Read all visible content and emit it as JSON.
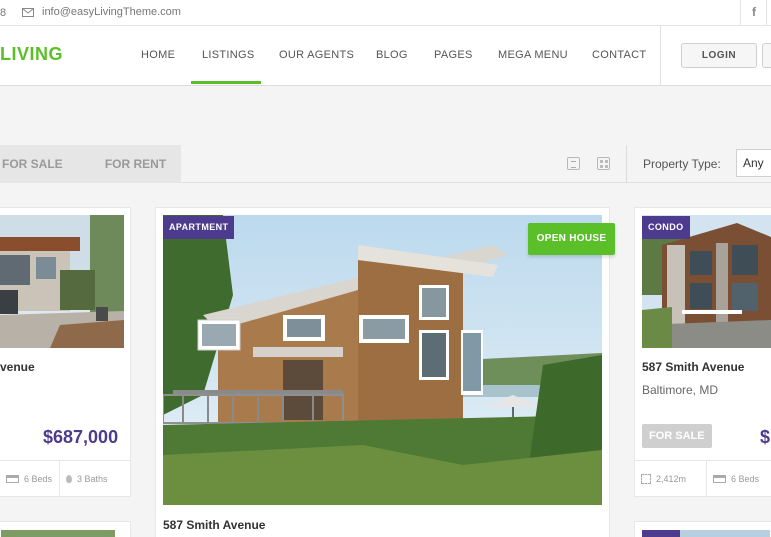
{
  "topbar": {
    "phone_tail": "8",
    "email": "info@easyLivingTheme.com",
    "social": "f"
  },
  "header": {
    "logo": "LIVING",
    "nav": [
      {
        "label": "HOME"
      },
      {
        "label": "LISTINGS"
      },
      {
        "label": "OUR AGENTS"
      },
      {
        "label": "BLOG"
      },
      {
        "label": "PAGES"
      },
      {
        "label": "MEGA MENU"
      },
      {
        "label": "CONTACT"
      }
    ],
    "active_nav": "LISTINGS",
    "login_label": "LOGIN"
  },
  "filters": {
    "tab_sale": "FOR SALE",
    "tab_rent": "FOR RENT",
    "property_type_label": "Property Type:",
    "property_type_value": "Any"
  },
  "listings": {
    "left": {
      "title": "venue",
      "price": "$687,000",
      "beds": "6 Beds",
      "baths": "3 Baths"
    },
    "middle": {
      "badge": "APARTMENT",
      "open_house": "OPEN HOUSE",
      "title": "587 Smith Avenue"
    },
    "right": {
      "badge": "CONDO",
      "title": "587 Smith Avenue",
      "location": "Baltimore, MD",
      "status": "FOR SALE",
      "price_partial": "$",
      "area": "2,412m",
      "beds": "6 Beds"
    }
  },
  "colors": {
    "accent_green": "#5bbf2a",
    "brand_purple": "#4d3b8e"
  }
}
